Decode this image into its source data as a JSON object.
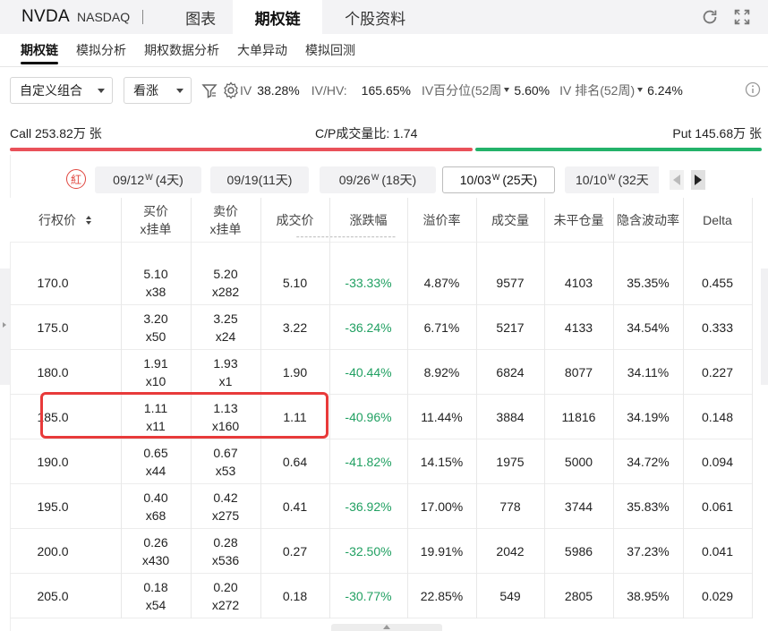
{
  "header": {
    "ticker": "NVDA",
    "exchange": "NASDAQ",
    "tabs": [
      "图表",
      "期权链",
      "个股资料"
    ],
    "active_tab": "期权链"
  },
  "subtabs": [
    "期权链",
    "模拟分析",
    "期权数据分析",
    "大单异动",
    "模拟回测"
  ],
  "filters": {
    "combo": "自定义组合",
    "direction": "看涨",
    "iv_label": "IV",
    "iv_value": "38.28%",
    "ivhv_label": "IV/HV:",
    "ivhv_value": "165.65%",
    "ivpct_label": "IV百分位(52周",
    "ivpct_value": "5.60%",
    "ivrank_label": "IV 排名(52周)",
    "ivrank_value": "6.24%"
  },
  "callput": {
    "call": "Call 253.82万 张",
    "ratio": "C/P成交量比: 1.74",
    "put": "Put 145.68万 张",
    "call_share": 0.635
  },
  "expiry": {
    "badge": "紅",
    "dates": [
      {
        "date": "09/12",
        "sup": "W",
        "days": "(4天)"
      },
      {
        "date": "09/19",
        "sup": "",
        "days": "(11天)"
      },
      {
        "date": "09/26",
        "sup": "W",
        "days": "(18天)"
      },
      {
        "date": "10/03",
        "sup": "W",
        "days": "(25天)"
      },
      {
        "date": "10/10",
        "sup": "W",
        "days": "(32天"
      }
    ],
    "active_index": 3
  },
  "table": {
    "headers": {
      "strike": "行权价",
      "bid_1": "买价",
      "bid_2": "x挂单",
      "ask_1": "卖价",
      "ask_2": "x挂单",
      "last": "成交价",
      "change": "涨跌幅",
      "premium": "溢价率",
      "volume": "成交量",
      "oi": "未平仓量",
      "iv": "隐含波动率",
      "delta": "Delta"
    },
    "rows": [
      {
        "strike": "170.0",
        "bid": "5.10",
        "bid_size": "x38",
        "ask": "5.20",
        "ask_size": "x282",
        "last": "5.10",
        "change": "-33.33%",
        "premium": "4.87%",
        "volume": "9577",
        "oi": "4103",
        "iv": "35.35%",
        "delta": "0.455"
      },
      {
        "strike": "175.0",
        "bid": "3.20",
        "bid_size": "x50",
        "ask": "3.25",
        "ask_size": "x24",
        "last": "3.22",
        "change": "-36.24%",
        "premium": "6.71%",
        "volume": "5217",
        "oi": "4133",
        "iv": "34.54%",
        "delta": "0.333"
      },
      {
        "strike": "180.0",
        "bid": "1.91",
        "bid_size": "x10",
        "ask": "1.93",
        "ask_size": "x1",
        "last": "1.90",
        "change": "-40.44%",
        "premium": "8.92%",
        "volume": "6824",
        "oi": "8077",
        "iv": "34.11%",
        "delta": "0.227"
      },
      {
        "strike": "185.0",
        "bid": "1.11",
        "bid_size": "x11",
        "ask": "1.13",
        "ask_size": "x160",
        "last": "1.11",
        "change": "-40.96%",
        "premium": "11.44%",
        "volume": "3884",
        "oi": "11816",
        "iv": "34.19%",
        "delta": "0.148"
      },
      {
        "strike": "190.0",
        "bid": "0.65",
        "bid_size": "x44",
        "ask": "0.67",
        "ask_size": "x53",
        "last": "0.64",
        "change": "-41.82%",
        "premium": "14.15%",
        "volume": "1975",
        "oi": "5000",
        "iv": "34.72%",
        "delta": "0.094"
      },
      {
        "strike": "195.0",
        "bid": "0.40",
        "bid_size": "x68",
        "ask": "0.42",
        "ask_size": "x275",
        "last": "0.41",
        "change": "-36.92%",
        "premium": "17.00%",
        "volume": "778",
        "oi": "3744",
        "iv": "35.83%",
        "delta": "0.061"
      },
      {
        "strike": "200.0",
        "bid": "0.26",
        "bid_size": "x430",
        "ask": "0.28",
        "ask_size": "x536",
        "last": "0.27",
        "change": "-32.50%",
        "premium": "19.91%",
        "volume": "2042",
        "oi": "5986",
        "iv": "37.23%",
        "delta": "0.041"
      },
      {
        "strike": "205.0",
        "bid": "0.18",
        "bid_size": "x54",
        "ask": "0.20",
        "ask_size": "x272",
        "last": "0.18",
        "change": "-30.77%",
        "premium": "22.85%",
        "volume": "549",
        "oi": "2805",
        "iv": "38.95%",
        "delta": "0.029"
      }
    ]
  },
  "colors": {
    "call_bar": "#e9515a",
    "put_bar": "#23b26a",
    "negative_change": "#21a062",
    "highlight_box": "#e83a3a"
  }
}
